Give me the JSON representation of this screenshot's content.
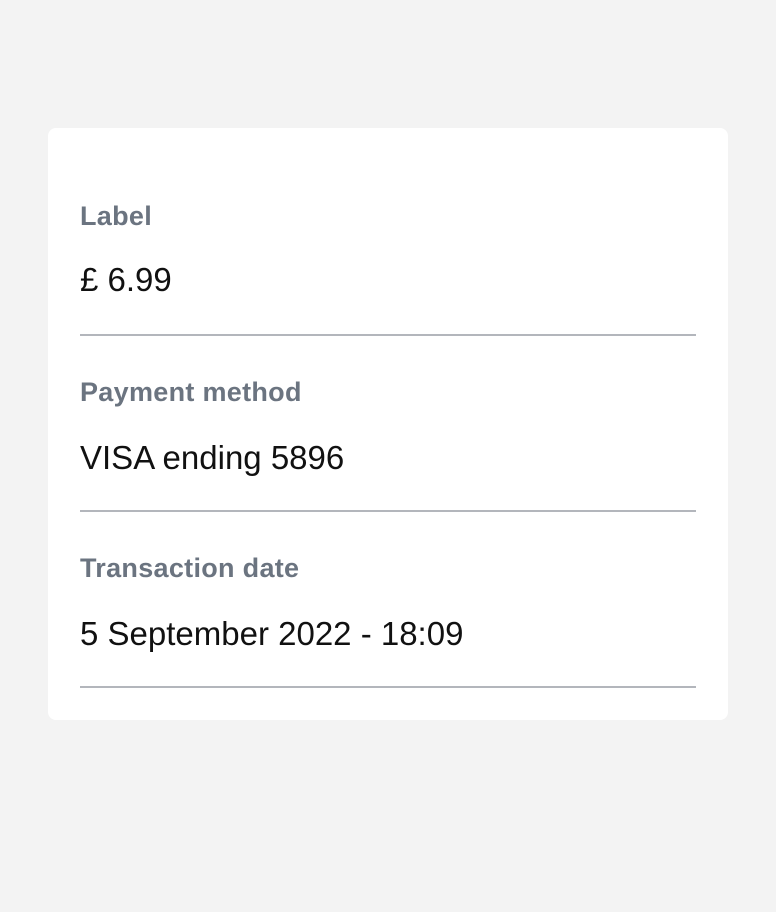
{
  "details": {
    "rows": [
      {
        "label": "Label",
        "value": "£ 6.99"
      },
      {
        "label": "Payment method",
        "value": "VISA ending 5896"
      },
      {
        "label": "Transaction date",
        "value": "5 September 2022 - 18:09"
      }
    ]
  }
}
